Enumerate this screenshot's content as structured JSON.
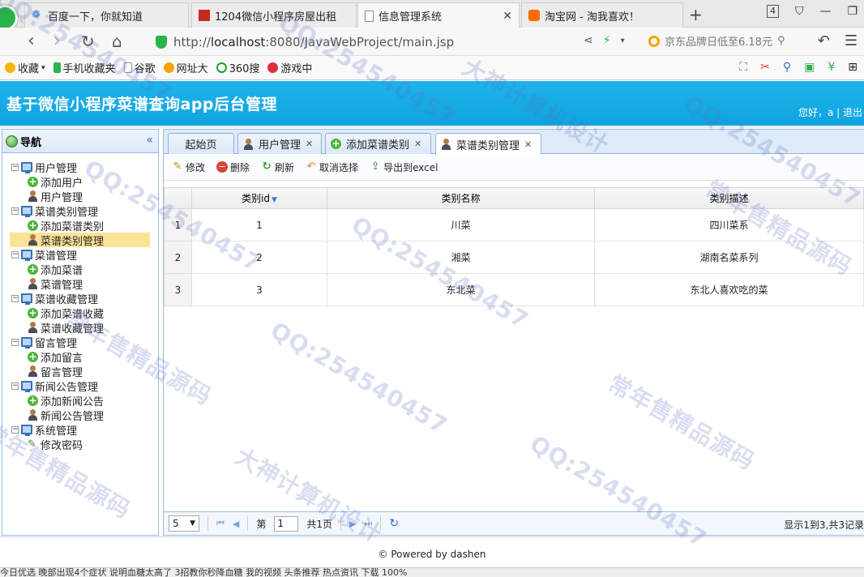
{
  "browser": {
    "tabs": [
      {
        "label": "百度一下，你就知道"
      },
      {
        "label": "1204微信小程序房屋出租"
      },
      {
        "label": "信息管理系统"
      },
      {
        "label": "淘宝网 - 淘我喜欢！"
      }
    ],
    "tab_count": "4",
    "url_prefix": "http://",
    "url_host": "localhost",
    "url_rest": ":8080/JavaWebProject/main.jsp",
    "search_placeholder": "京东品牌日低至6.18元",
    "bookmarks": [
      {
        "label": "收藏",
        "color": "#f2b705"
      },
      {
        "label": "手机收藏夹",
        "color": "#2db24a"
      },
      {
        "label": "谷歌",
        "color": "#cfcfcf"
      },
      {
        "label": "网址大",
        "color": "#f5a300"
      },
      {
        "label": "360搜",
        "color": "#1fa22e"
      },
      {
        "label": "游戏中",
        "color": "#e0303a"
      }
    ]
  },
  "app": {
    "title": "基于微信小程序菜谱查询app后台管理",
    "user_greeting": "您好，a | 退出"
  },
  "nav": {
    "title": "导航",
    "groups": [
      {
        "label": "用户管理",
        "children": [
          {
            "label": "添加用户",
            "icon": "add"
          },
          {
            "label": "用户管理",
            "icon": "user"
          }
        ]
      },
      {
        "label": "菜谱类别管理",
        "children": [
          {
            "label": "添加菜谱类别",
            "icon": "add"
          },
          {
            "label": "菜谱类别管理",
            "icon": "user"
          }
        ]
      },
      {
        "label": "菜谱管理",
        "children": [
          {
            "label": "添加菜谱",
            "icon": "add"
          },
          {
            "label": "菜谱管理",
            "icon": "user"
          }
        ]
      },
      {
        "label": "菜谱收藏管理",
        "children": [
          {
            "label": "添加菜谱收藏",
            "icon": "add"
          },
          {
            "label": "菜谱收藏管理",
            "icon": "user"
          }
        ]
      },
      {
        "label": "留言管理",
        "children": [
          {
            "label": "添加留言",
            "icon": "add"
          },
          {
            "label": "留言管理",
            "icon": "user"
          }
        ]
      },
      {
        "label": "新闻公告管理",
        "children": [
          {
            "label": "添加新闻公告",
            "icon": "add"
          },
          {
            "label": "新闻公告管理",
            "icon": "user"
          }
        ]
      },
      {
        "label": "系统管理",
        "children": [
          {
            "label": "修改密码",
            "icon": "pen"
          }
        ]
      }
    ]
  },
  "content_tabs": [
    {
      "label": "起始页"
    },
    {
      "label": "用户管理"
    },
    {
      "label": "添加菜谱类别"
    },
    {
      "label": "菜谱类别管理"
    }
  ],
  "toolbar": {
    "edit": "修改",
    "delete": "删除",
    "refresh": "刷新",
    "unselect": "取消选择",
    "export": "导出到excel"
  },
  "table": {
    "columns": [
      "类别id",
      "类别名称",
      "类别描述"
    ],
    "rows": [
      {
        "num": "1",
        "id": "1",
        "name": "川菜",
        "desc": "四川菜系"
      },
      {
        "num": "2",
        "id": "2",
        "name": "湘菜",
        "desc": "湖南名菜系列"
      },
      {
        "num": "3",
        "id": "3",
        "name": "东北菜",
        "desc": "东北人喜欢吃的菜"
      }
    ]
  },
  "pager": {
    "page_size": "5",
    "page_prefix": "第",
    "current_page": "1",
    "page_suffix": "共1页",
    "info": "显示1到3,共3记录"
  },
  "footer": "© Powered by dashen",
  "statusbar": "今日优选    晚部出现4个症状    说明血糖太高了    3招教你秒降血糖    我的视频    头条推荐    热点资讯    下载    100%",
  "watermarks": [
    "QQ:254540457",
    "大神计算机设计",
    "常年售精品源码"
  ]
}
